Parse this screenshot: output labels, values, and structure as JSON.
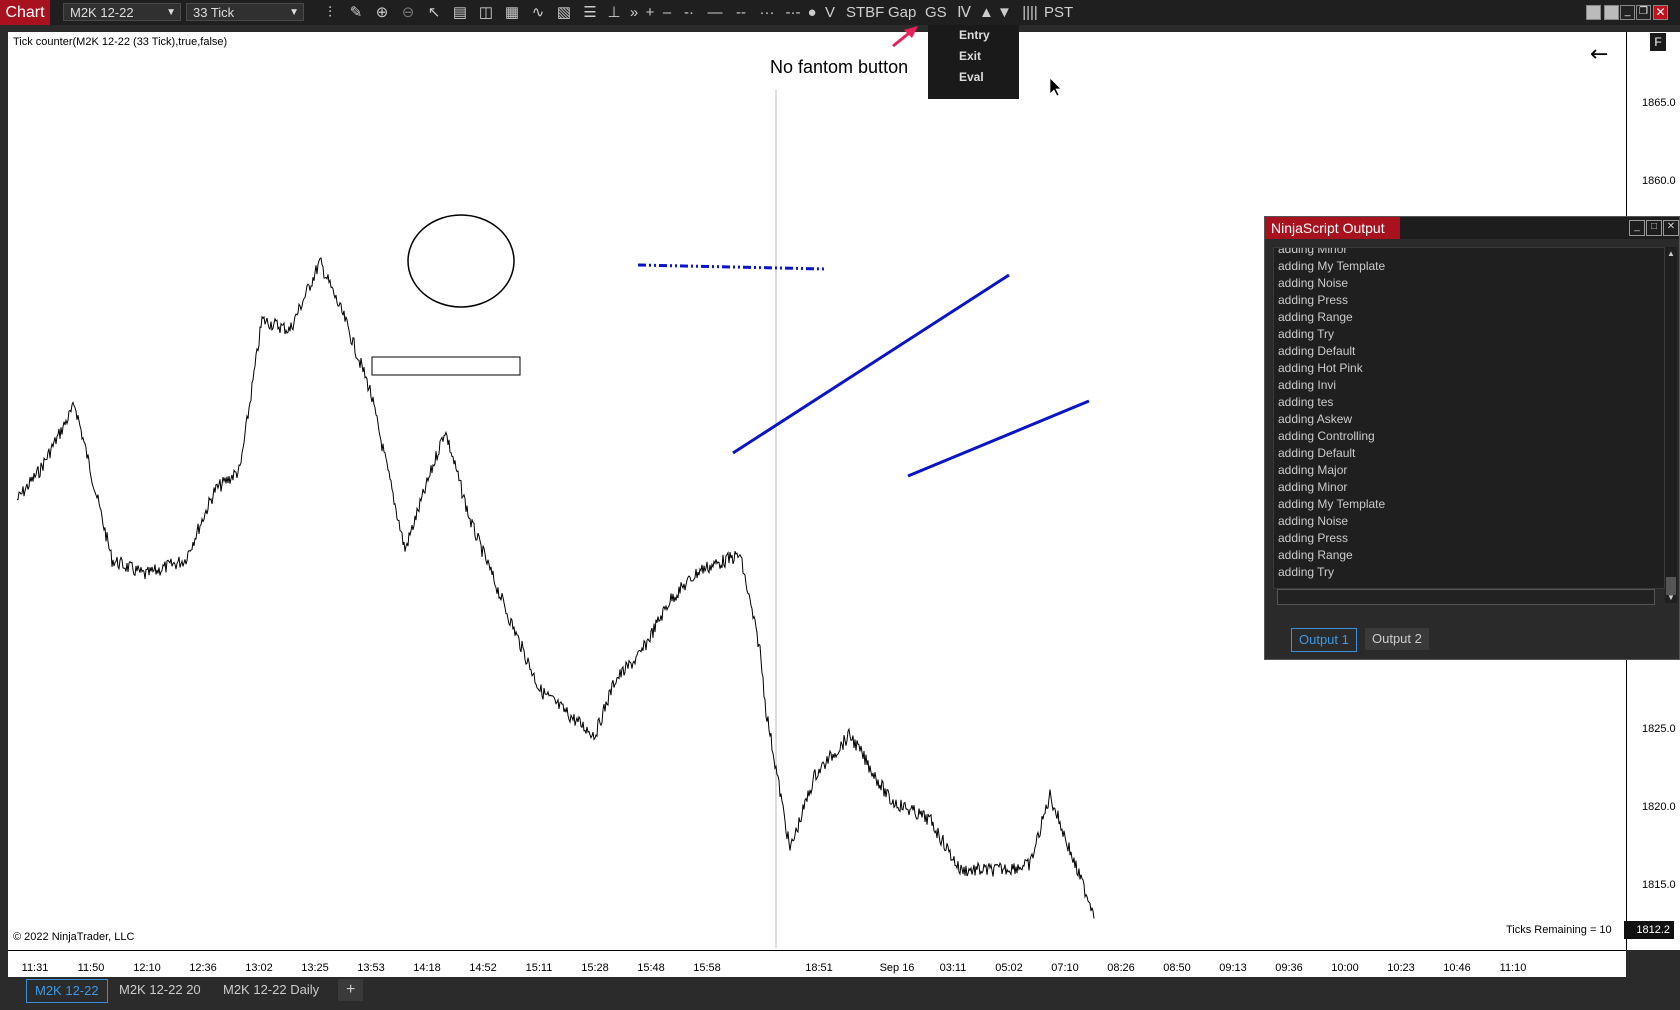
{
  "toolbar": {
    "title": "Chart",
    "instrument": "M2K 12-22",
    "interval": "33 Tick",
    "label_v": "V",
    "label_stbf": "STBF",
    "label_gap": "Gap",
    "label_gs": "GS",
    "label_pst": "PST"
  },
  "menu": {
    "items": [
      "Entry",
      "Exit",
      "Eval"
    ]
  },
  "chart": {
    "indicator_label": "Tick counter(M2K 12-22 (33 Tick),true,false)",
    "annotation": "No fantom button",
    "copyright": "© 2022 NinjaTrader, LLC",
    "ticks_remaining": "Ticks Remaining = 10",
    "flag": "F",
    "last_price": "1812.2",
    "price_labels": [
      "1865.0",
      "1860.0",
      "1825.0",
      "1820.0",
      "1815.0"
    ],
    "time_labels": [
      "11:31",
      "11:50",
      "12:10",
      "12:36",
      "13:02",
      "13:25",
      "13:53",
      "14:18",
      "14:52",
      "15:11",
      "15:28",
      "15:48",
      "15:58",
      "18:51",
      "Sep 16",
      "03:11",
      "05:02",
      "07:10",
      "08:26",
      "08:50",
      "09:13",
      "09:36",
      "10:00",
      "10:23",
      "10:46",
      "11:10"
    ],
    "line_color": "#0a14c8",
    "accent_red": "#a8121e"
  },
  "output": {
    "title": "NinjaScript Output",
    "lines": [
      "adding Minor",
      "adding My Template",
      "adding Noise",
      "adding Press",
      "adding Range",
      "adding Try",
      "adding Default",
      "adding Hot Pink",
      "adding Invi",
      "adding tes",
      "adding Askew",
      "adding Controlling",
      "adding Default",
      "adding Major",
      "adding Minor",
      "adding My Template",
      "adding Noise",
      "adding Press",
      "adding Range",
      "adding Try"
    ],
    "tab1": "Output 1",
    "tab2": "Output 2"
  },
  "bottom_tabs": [
    "M2K 12-22",
    "M2K 12-22 20",
    "M2K 12-22 Daily"
  ],
  "add_tab": "+"
}
